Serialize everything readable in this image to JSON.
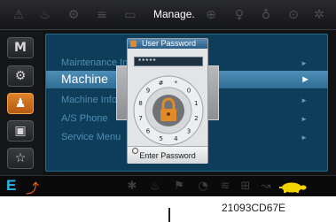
{
  "topbar": {
    "title": "Manage.",
    "icons": [
      "warning-icon",
      "engine-icon",
      "engine-temp-icon",
      "battery-charge-icon",
      "battery-icon",
      "brake-icon",
      "key-icon",
      "hydraulic-icon",
      "parking-brake-icon",
      "light-icon"
    ]
  },
  "sidebar": {
    "buttons": [
      {
        "label": "M",
        "icon": "menu-m-icon"
      },
      {
        "label": "⚙",
        "icon": "gear-icon"
      },
      {
        "label": "♟",
        "icon": "person-icon",
        "active": true
      },
      {
        "label": "▣",
        "icon": "tv-icon"
      },
      {
        "label": "☆",
        "icon": "star-icon"
      }
    ]
  },
  "menu": {
    "items": [
      {
        "label": "Maintenance Inf",
        "arrow": "►"
      },
      {
        "label": "Machine",
        "arrow": "►",
        "selected": true
      },
      {
        "label": "Machine Info",
        "arrow": "►"
      },
      {
        "label": "A/S Phone",
        "arrow": "►"
      },
      {
        "label": "Service Menu",
        "arrow": "►"
      }
    ]
  },
  "dialog": {
    "title": "User Password",
    "password_value": "*****",
    "dial_digits": [
      "0",
      "1",
      "2",
      "3",
      "4",
      "5",
      "6",
      "7",
      "8",
      "9"
    ],
    "extra_keys": [
      "#",
      "*"
    ],
    "button_label": "Enter Password",
    "colors": {
      "dial_ring": "#e9eaeb",
      "dial_center": "#6f7377",
      "lock": "#e08a28",
      "header": "#3c6f9a"
    }
  },
  "bottombar": {
    "mode_letter": "E",
    "icons": [
      "pedal-icon",
      "power-max-icon",
      "hyd-temp-icon",
      "fuel-warning-icon",
      "auto-idle-icon",
      "overload-icon",
      "breaker-icon",
      "travel-icon",
      "turtle-icon"
    ]
  },
  "caption": "21093CD67E",
  "colors": {
    "accent_blue": "#22b7e8",
    "accent_orange": "#ff6a1a",
    "panel_bg": "#0e3d5a",
    "selected_row": "#3f7ea6"
  }
}
